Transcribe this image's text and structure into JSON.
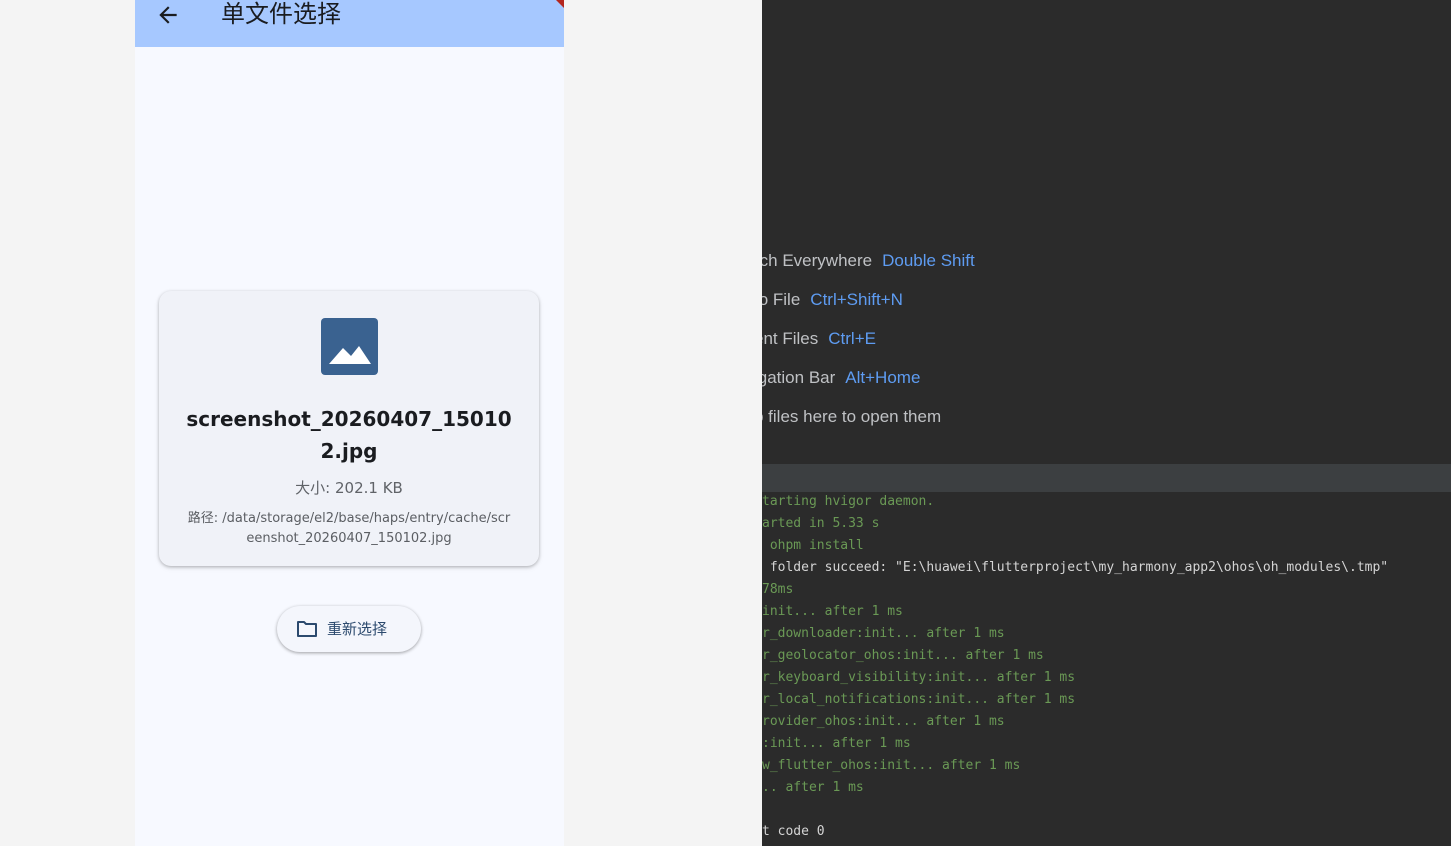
{
  "app": {
    "title": "单文件选择",
    "file": {
      "name": "screenshot_20260407_150102.jpg",
      "size_text": "大小: 202.1 KB",
      "path_text": "路径: /data/storage/el2/base/haps/entry/cache/screenshot_20260407_150102.jpg"
    },
    "reselect_label": "重新选择"
  },
  "ide": {
    "hints": [
      {
        "label": "rch Everywhere",
        "shortcut": "Double Shift"
      },
      {
        "label": "to File",
        "shortcut": "Ctrl+Shift+N"
      },
      {
        "label": "ent Files",
        "shortcut": "Ctrl+E"
      },
      {
        "label": "igation Bar",
        "shortcut": "Alt+Home"
      }
    ],
    "drop_hint": "p files here to open them",
    "console_lines": [
      "tarting hvigor daemon.",
      "arted in 5.33 s",
      " ohpm install",
      " folder succeed: \"E:\\huawei\\flutterproject\\my_harmony_app2\\ohos\\oh_modules\\.tmp\"",
      "78ms",
      "init... after 1 ms",
      "r_downloader:init... after 1 ms",
      "r_geolocator_ohos:init... after 1 ms",
      "r_keyboard_visibility:init... after 1 ms",
      "r_local_notifications:init... after 1 ms",
      "rovider_ohos:init... after 1 ms",
      ":init... after 1 ms",
      "w_flutter_ohos:init... after 1 ms",
      ".. after 1 ms",
      "",
      "t code 0"
    ]
  },
  "colors": {
    "appbar": "#a6c8ff",
    "ide_background": "#2b2b2b",
    "shortcut_blue": "#5e9cf2",
    "console_green": "#6a9955"
  }
}
